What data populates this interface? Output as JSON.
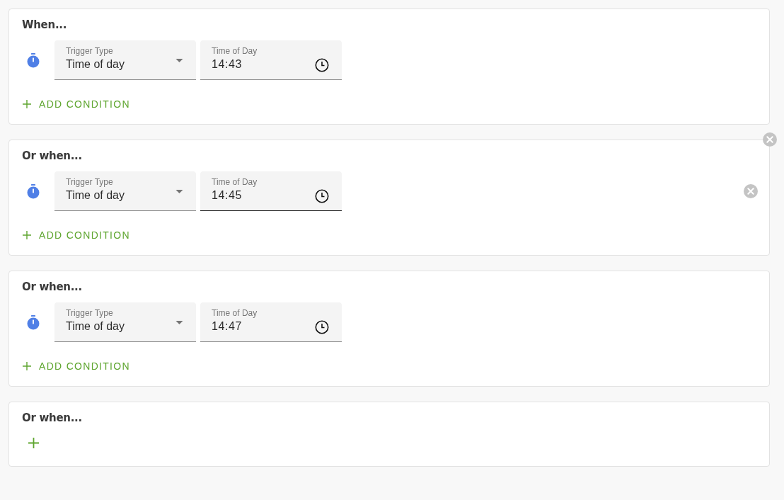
{
  "cards": [
    {
      "kind": "group",
      "title": "When...",
      "hovered": false,
      "conditions": [
        {
          "trigger": {
            "label": "Trigger Type",
            "value": "Time of day"
          },
          "time": {
            "label": "Time of Day",
            "value": "14:43",
            "focused": false
          }
        }
      ],
      "add_label": "ADD CONDITION"
    },
    {
      "kind": "group",
      "title": "Or when...",
      "hovered": true,
      "conditions": [
        {
          "trigger": {
            "label": "Trigger Type",
            "value": "Time of day"
          },
          "time": {
            "label": "Time of Day",
            "value": "14:45",
            "focused": true
          }
        }
      ],
      "add_label": "ADD CONDITION"
    },
    {
      "kind": "group",
      "title": "Or when...",
      "hovered": false,
      "conditions": [
        {
          "trigger": {
            "label": "Trigger Type",
            "value": "Time of day"
          },
          "time": {
            "label": "Time of Day",
            "value": "14:47",
            "focused": false
          }
        }
      ],
      "add_label": "ADD CONDITION"
    },
    {
      "kind": "new",
      "title": "Or when..."
    }
  ]
}
